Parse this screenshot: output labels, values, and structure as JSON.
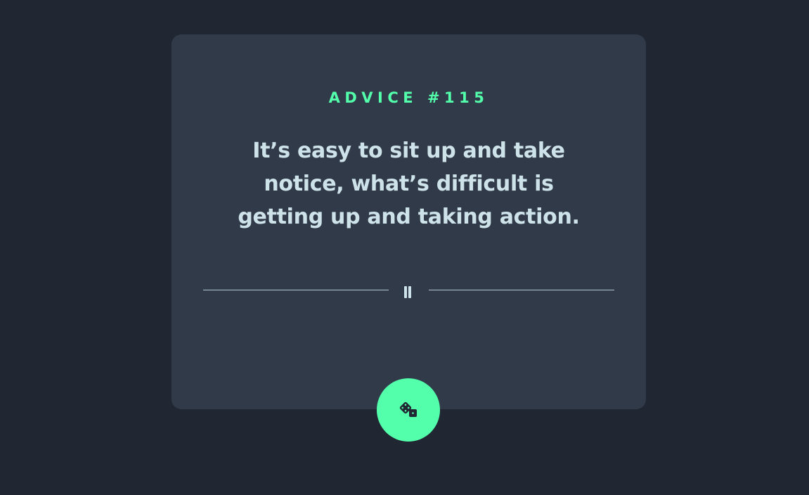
{
  "card": {
    "advice_label": "ADVICE #115",
    "quote": "It’s easy to sit up and take notice, what’s difficult is getting up and taking action."
  },
  "divider": {
    "icon": "pause-icon"
  },
  "generate_button": {
    "icon": "dice-icon"
  },
  "colors": {
    "background": "#202632",
    "card": "#313a49",
    "accent": "#53ffab",
    "text": "#cee3e9"
  }
}
